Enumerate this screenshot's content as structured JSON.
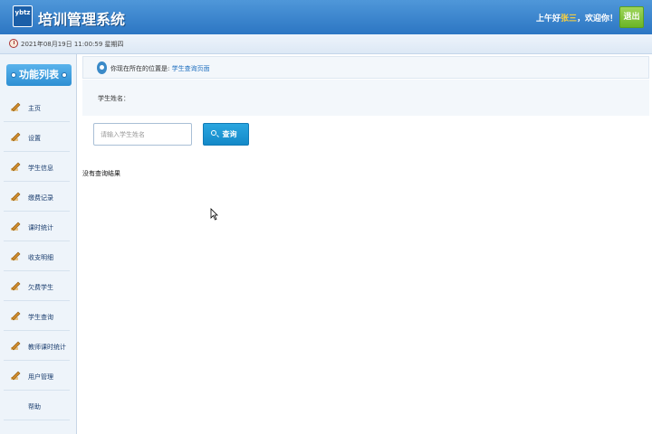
{
  "header": {
    "logo_text": "ybtz",
    "title": "培训管理系统",
    "greeting_prefix": "上午好",
    "username": "张三",
    "greeting_suffix": "，欢迎你！",
    "logout_label": "退出"
  },
  "datebar": {
    "datetime": "2021年08月19日 11:00:59 星期四"
  },
  "sidebar": {
    "title": "功能列表",
    "items": [
      {
        "label": "主页"
      },
      {
        "label": "设置"
      },
      {
        "label": "学生信息"
      },
      {
        "label": "缴费记录"
      },
      {
        "label": "课时统计"
      },
      {
        "label": "收支明细"
      },
      {
        "label": "欠费学生"
      },
      {
        "label": "学生查询"
      },
      {
        "label": "教师课时统计"
      },
      {
        "label": "用户管理"
      },
      {
        "label": "帮助"
      }
    ]
  },
  "breadcrumb": {
    "prefix": "你现在所在的位置是:",
    "current": "学生查询页面"
  },
  "search": {
    "field_label": "学生姓名：",
    "input_value": "",
    "placeholder": "请输入学生姓名",
    "button_label": "查询"
  },
  "result": {
    "message": "没有查询结果"
  },
  "colors": {
    "header_blue": "#3a86d0",
    "accent_green": "#7cc23a",
    "button_blue": "#1e98d6",
    "username_yellow": "#ffd23a"
  }
}
